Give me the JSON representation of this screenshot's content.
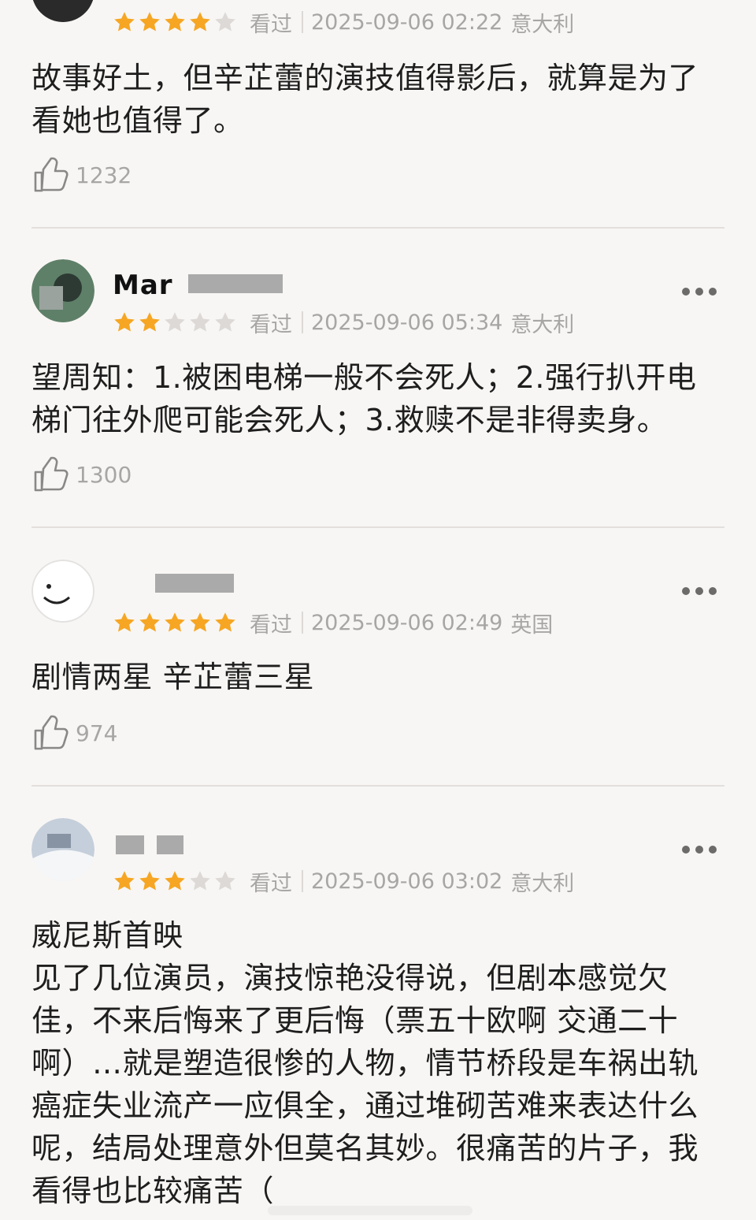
{
  "reviews": [
    {
      "user": "",
      "rating": 4,
      "status": "看过",
      "date": "2025-09-06 02:22",
      "region": "意大利",
      "text": "故事好土，但辛芷蕾的演技值得影后，就算是为了\n看她也值得了。",
      "likes": "1232"
    },
    {
      "user": "Mar  ",
      "rating": 2,
      "status": "看过",
      "date": "2025-09-06 05:34",
      "region": "意大利",
      "text": "望周知：1.被困电梯一般不会死人；2.强行扒开电\n梯门往外爬可能会死人；3.救赎不是非得卖身。",
      "likes": "1300"
    },
    {
      "user": "",
      "rating": 5,
      "status": "看过",
      "date": "2025-09-06 02:49",
      "region": "英国",
      "text": "剧情两星 辛芷蕾三星",
      "likes": "974"
    },
    {
      "user": "",
      "rating": 3,
      "status": "看过",
      "date": "2025-09-06 03:02",
      "region": "意大利",
      "text": "威尼斯首映\n见了几位演员，演技惊艳没得说，但剧本感觉欠\n佳，不来后悔来了更后悔（票五十欧啊 交通二十\n啊）…就是塑造很惨的人物，情节桥段是车祸出轨\n癌症失业流产一应俱全，通过堆砌苦难来表达什么\n呢，结局处理意外但莫名其妙。很痛苦的片子，我\n看得也比较痛苦（",
      "likes": ""
    }
  ],
  "icons": {
    "like": "thumbs-up-icon",
    "more": "more-dots-icon",
    "star": "star-icon"
  },
  "colors": {
    "background": "#f8f6f4",
    "star_on": "#f6a623",
    "star_off": "#dcd9d6",
    "meta_text": "#a8a6a4"
  }
}
